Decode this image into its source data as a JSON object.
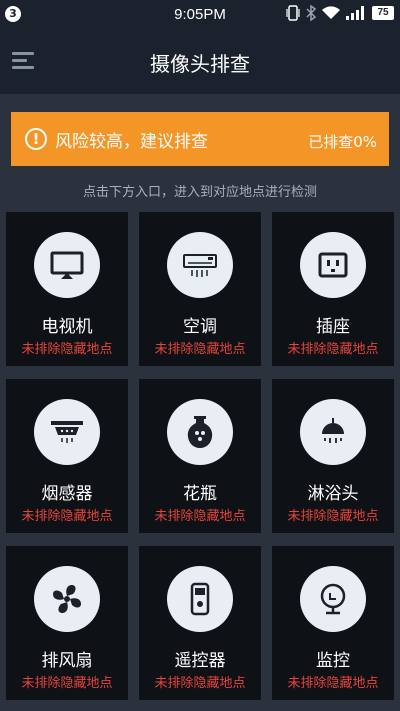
{
  "status_bar": {
    "notification_count": "3",
    "time": "9:05PM",
    "battery": "75",
    "icons": [
      "vibrate-icon",
      "bluetooth-icon",
      "wifi-icon",
      "signal-icon",
      "battery-icon"
    ]
  },
  "app_bar": {
    "title": "摄像头排查",
    "menu_icon": "menu-icon"
  },
  "banner": {
    "icon": "warning-icon",
    "text": "风险较高，建议排查",
    "progress": "已排查0%",
    "color": "#f39527"
  },
  "hint": "点击下方入口，进入到对应地点进行检测",
  "locations": [
    {
      "label": "电视机",
      "status": "未排除隐藏地点",
      "icon": "tv-icon"
    },
    {
      "label": "空调",
      "status": "未排除隐藏地点",
      "icon": "air-conditioner-icon"
    },
    {
      "label": "插座",
      "status": "未排除隐藏地点",
      "icon": "socket-icon"
    },
    {
      "label": "烟感器",
      "status": "未排除隐藏地点",
      "icon": "smoke-detector-icon"
    },
    {
      "label": "花瓶",
      "status": "未排除隐藏地点",
      "icon": "vase-icon"
    },
    {
      "label": "淋浴头",
      "status": "未排除隐藏地点",
      "icon": "shower-icon"
    },
    {
      "label": "排风扇",
      "status": "未排除隐藏地点",
      "icon": "fan-icon"
    },
    {
      "label": "遥控器",
      "status": "未排除隐藏地点",
      "icon": "remote-icon"
    },
    {
      "label": "监控",
      "status": "未排除隐藏地点",
      "icon": "camera-icon"
    }
  ],
  "colors": {
    "background": "#2b323e",
    "header": "#1c222d",
    "cell": "#0e1116",
    "status_red": "#e8443b"
  }
}
